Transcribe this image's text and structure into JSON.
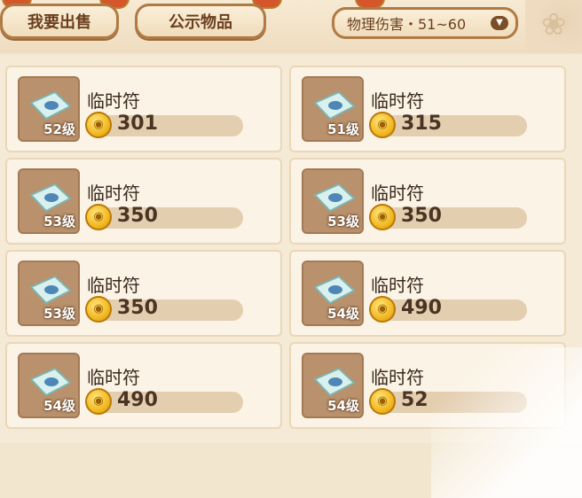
{
  "tabs": [
    {
      "label": "我要出售"
    },
    {
      "label": "公示物品"
    }
  ],
  "filter": {
    "label": "物理伤害・51~60"
  },
  "colors": {
    "accent": "#b07a44",
    "coin": "#f0b51e"
  },
  "items": [
    {
      "name": "临时符",
      "level": "52级",
      "price": "301",
      "icon": "talisman-icon"
    },
    {
      "name": "临时符",
      "level": "51级",
      "price": "315",
      "icon": "talisman-icon"
    },
    {
      "name": "临时符",
      "level": "53级",
      "price": "350",
      "icon": "talisman-icon"
    },
    {
      "name": "临时符",
      "level": "53级",
      "price": "350",
      "icon": "talisman-icon"
    },
    {
      "name": "临时符",
      "level": "53级",
      "price": "350",
      "icon": "talisman-icon"
    },
    {
      "name": "临时符",
      "level": "54级",
      "price": "490",
      "icon": "talisman-icon"
    },
    {
      "name": "临时符",
      "level": "54级",
      "price": "490",
      "icon": "talisman-icon"
    },
    {
      "name": "临时符",
      "level": "54级",
      "price": "52",
      "icon": "talisman-icon"
    }
  ]
}
